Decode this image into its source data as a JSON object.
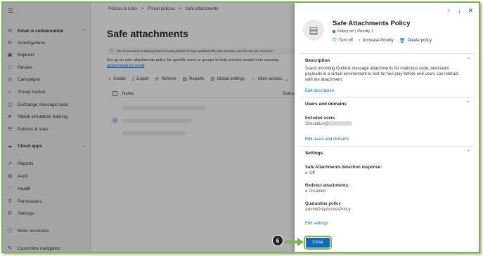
{
  "sidebar": {
    "items": [
      {
        "label": "Email & collaboration",
        "icon": "mail-icon",
        "section": true,
        "chevron": "^"
      },
      {
        "label": "Investigations",
        "icon": "investigation-icon"
      },
      {
        "label": "Explorer",
        "icon": "explorer-icon"
      },
      {
        "label": "Review",
        "icon": "review-icon"
      },
      {
        "label": "Campaigns",
        "icon": "campaigns-icon"
      },
      {
        "label": "Threat tracker",
        "icon": "threat-tracker-icon"
      },
      {
        "label": "Exchange message trace",
        "icon": "exchange-icon"
      },
      {
        "label": "Attack simulation training",
        "icon": "simulation-icon"
      },
      {
        "label": "Policies & rules",
        "icon": "policies-icon"
      },
      {
        "label": "Cloud apps",
        "icon": "cloud-icon",
        "section": true,
        "chevron": "v"
      },
      {
        "label": "Reports",
        "icon": "reports-icon"
      },
      {
        "label": "Audit",
        "icon": "audit-icon"
      },
      {
        "label": "Health",
        "icon": "health-icon"
      },
      {
        "label": "Permissions",
        "icon": "permissions-icon"
      },
      {
        "label": "Settings",
        "icon": "settings-icon"
      },
      {
        "label": "More resources",
        "icon": "more-resources-icon"
      },
      {
        "label": "Customize navigation",
        "icon": "customize-icon"
      }
    ]
  },
  "main": {
    "breadcrumbs": [
      "Policies & rules",
      ">",
      "Threat policies",
      ">",
      "Safe attachments"
    ],
    "title": "Safe attachments",
    "banner": "We recommend enabling preset security policies to stay updated with new security controls and our recomme",
    "intro": "Set up an safe attachments policy for specific users or groups to help prevent people from opening",
    "intro_link": "attachments for email",
    "toolbar": [
      "Create",
      "Export",
      "Refresh",
      "Reports",
      "Global settings",
      "More actions"
    ],
    "columns": {
      "name": "Name",
      "status": "Status"
    }
  },
  "panel": {
    "title": "Safe Attachments Policy",
    "status": "Policy on | Priority 1",
    "actions": [
      "Turn off",
      "Increase Priority",
      "Delete policy"
    ],
    "description": {
      "heading": "Description",
      "text_1": "Scans incoming Outlook message attachments for malicious code, detonates",
      "text_2": "payloads in a virtual environment to test for foul play before end users can interact",
      "text_3": "with the attachment.",
      "link": "Edit description"
    },
    "users": {
      "heading": "Users and domains",
      "label": "Included users",
      "value": "Simulation@",
      "link": "Edit users and domains"
    },
    "settings": {
      "heading": "Settings",
      "detection_label": "Safe Attachments detection response:",
      "detection_value": "Off",
      "redirect_label": "Redirect attachments:",
      "redirect_value": "Disabled",
      "quarantine_label": "Quarantine policy",
      "quarantine_value": "AdminOnlyAccessPolicy",
      "link": "Edit settings"
    },
    "close_label": "Close"
  },
  "annotation": {
    "step": "6"
  },
  "colors": {
    "accent": "#0f6cbd",
    "callout": "#7ab648",
    "status_on": "#13a10e"
  }
}
